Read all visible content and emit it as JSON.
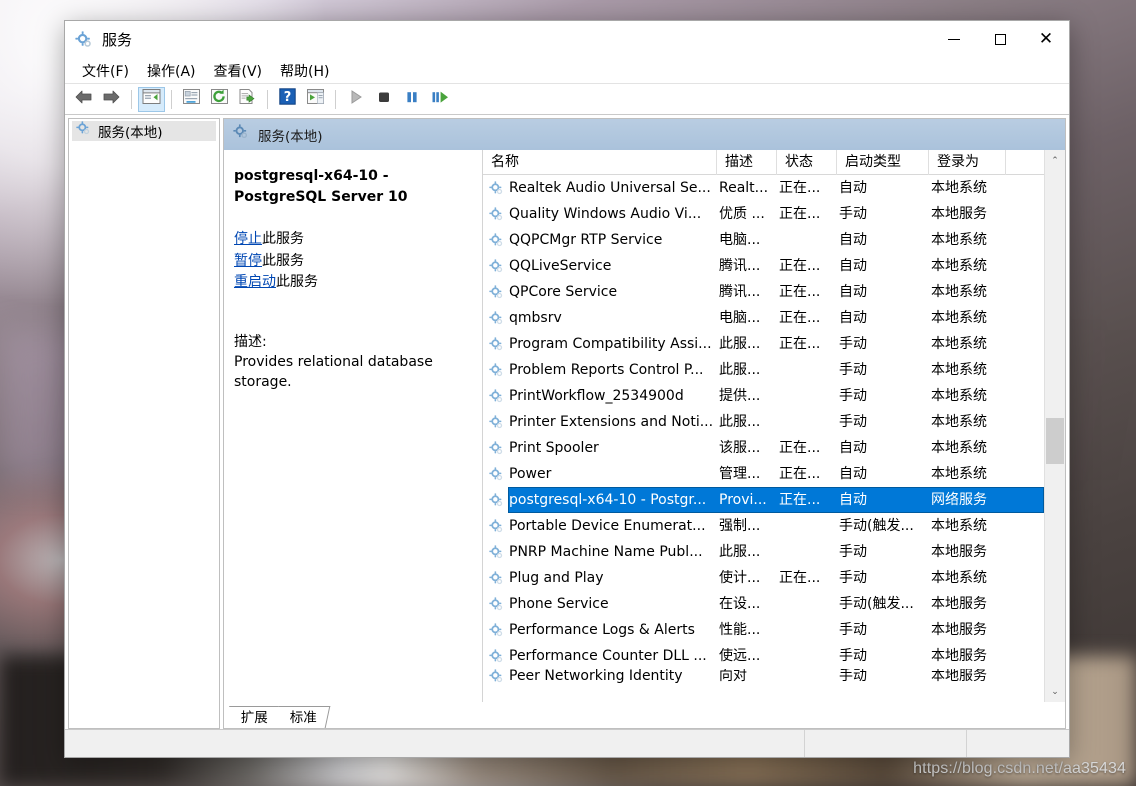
{
  "window": {
    "title": "服务",
    "icon": "services-gear-icon",
    "buttons": {
      "minimize": "—",
      "maximize": "□",
      "close": "✕"
    }
  },
  "menubar": {
    "items": [
      {
        "label": "文件(F)",
        "name": "menu-file"
      },
      {
        "label": "操作(A)",
        "name": "menu-action"
      },
      {
        "label": "查看(V)",
        "name": "menu-view"
      },
      {
        "label": "帮助(H)",
        "name": "menu-help"
      }
    ]
  },
  "toolbar": {
    "buttons": [
      {
        "name": "back-icon"
      },
      {
        "name": "forward-icon"
      },
      {
        "name": "show-hide-console-tree-icon"
      },
      {
        "name": "properties-icon"
      },
      {
        "name": "refresh-icon"
      },
      {
        "name": "export-list-icon"
      },
      {
        "name": "help-icon"
      },
      {
        "name": "show-action-pane-icon"
      },
      {
        "name": "start-service-icon"
      },
      {
        "name": "stop-service-icon"
      },
      {
        "name": "pause-service-icon"
      },
      {
        "name": "restart-service-icon"
      }
    ]
  },
  "tree": {
    "node_label": "服务(本地)"
  },
  "content_header": {
    "label": "服务(本地)"
  },
  "detail": {
    "title": "postgresql-x64-10 - PostgreSQL Server 10",
    "links": [
      {
        "link": "停止",
        "suffix": "此服务",
        "name": "stop-service-link"
      },
      {
        "link": "暂停",
        "suffix": "此服务",
        "name": "pause-service-link"
      },
      {
        "link": "重启动",
        "suffix": "此服务",
        "name": "restart-service-link"
      }
    ],
    "description_label": "描述:",
    "description_body": "Provides relational database storage."
  },
  "list": {
    "columns": [
      {
        "key": "name",
        "label": "名称"
      },
      {
        "key": "desc",
        "label": "描述"
      },
      {
        "key": "status",
        "label": "状态"
      },
      {
        "key": "start",
        "label": "启动类型"
      },
      {
        "key": "logon",
        "label": "登录为"
      }
    ],
    "rows": [
      {
        "name": "Realtek Audio Universal Se...",
        "desc": "Realt...",
        "status": "正在...",
        "start": "自动",
        "logon": "本地系统",
        "selected": false
      },
      {
        "name": "Quality Windows Audio Vi...",
        "desc": "优质 ...",
        "status": "正在...",
        "start": "手动",
        "logon": "本地服务",
        "selected": false
      },
      {
        "name": "QQPCMgr RTP Service",
        "desc": "电脑...",
        "status": "",
        "start": "自动",
        "logon": "本地系统",
        "selected": false
      },
      {
        "name": "QQLiveService",
        "desc": "腾讯...",
        "status": "正在...",
        "start": "自动",
        "logon": "本地系统",
        "selected": false
      },
      {
        "name": "QPCore Service",
        "desc": "腾讯...",
        "status": "正在...",
        "start": "自动",
        "logon": "本地系统",
        "selected": false
      },
      {
        "name": "qmbsrv",
        "desc": "电脑...",
        "status": "正在...",
        "start": "自动",
        "logon": "本地系统",
        "selected": false
      },
      {
        "name": "Program Compatibility Assi...",
        "desc": "此服...",
        "status": "正在...",
        "start": "手动",
        "logon": "本地系统",
        "selected": false
      },
      {
        "name": "Problem Reports Control P...",
        "desc": "此服...",
        "status": "",
        "start": "手动",
        "logon": "本地系统",
        "selected": false
      },
      {
        "name": "PrintWorkflow_2534900d",
        "desc": "提供...",
        "status": "",
        "start": "手动",
        "logon": "本地系统",
        "selected": false
      },
      {
        "name": "Printer Extensions and Noti...",
        "desc": "此服...",
        "status": "",
        "start": "手动",
        "logon": "本地系统",
        "selected": false
      },
      {
        "name": "Print Spooler",
        "desc": "该服...",
        "status": "正在...",
        "start": "自动",
        "logon": "本地系统",
        "selected": false
      },
      {
        "name": "Power",
        "desc": "管理...",
        "status": "正在...",
        "start": "自动",
        "logon": "本地系统",
        "selected": false
      },
      {
        "name": "postgresql-x64-10 - Postgr...",
        "desc": "Provi...",
        "status": "正在...",
        "start": "自动",
        "logon": "网络服务",
        "selected": true
      },
      {
        "name": "Portable Device Enumerat...",
        "desc": "强制...",
        "status": "",
        "start": "手动(触发...",
        "logon": "本地系统",
        "selected": false
      },
      {
        "name": "PNRP Machine Name Publ...",
        "desc": "此服...",
        "status": "",
        "start": "手动",
        "logon": "本地服务",
        "selected": false
      },
      {
        "name": "Plug and Play",
        "desc": "使计...",
        "status": "正在...",
        "start": "手动",
        "logon": "本地系统",
        "selected": false
      },
      {
        "name": "Phone Service",
        "desc": "在设...",
        "status": "",
        "start": "手动(触发...",
        "logon": "本地服务",
        "selected": false
      },
      {
        "name": "Performance Logs & Alerts",
        "desc": "性能...",
        "status": "",
        "start": "手动",
        "logon": "本地服务",
        "selected": false
      },
      {
        "name": "Performance Counter DLL ...",
        "desc": "使远...",
        "status": "",
        "start": "手动",
        "logon": "本地服务",
        "selected": false
      },
      {
        "name": "Peer Networking Identity",
        "desc": "向对",
        "status": "",
        "start": "手动",
        "logon": "本地服务",
        "selected": false
      }
    ],
    "scrollbar": {
      "up": "⌃",
      "down": "⌄"
    }
  },
  "tabs": [
    {
      "label": "扩展",
      "name": "tab-extended",
      "active": false
    },
    {
      "label": "标准",
      "name": "tab-standard",
      "active": true
    }
  ],
  "watermark": "https://blog.csdn.net/aa35434",
  "colors": {
    "selection": "#0078d7",
    "link": "#0047b3",
    "header_band": "#aac2db"
  }
}
